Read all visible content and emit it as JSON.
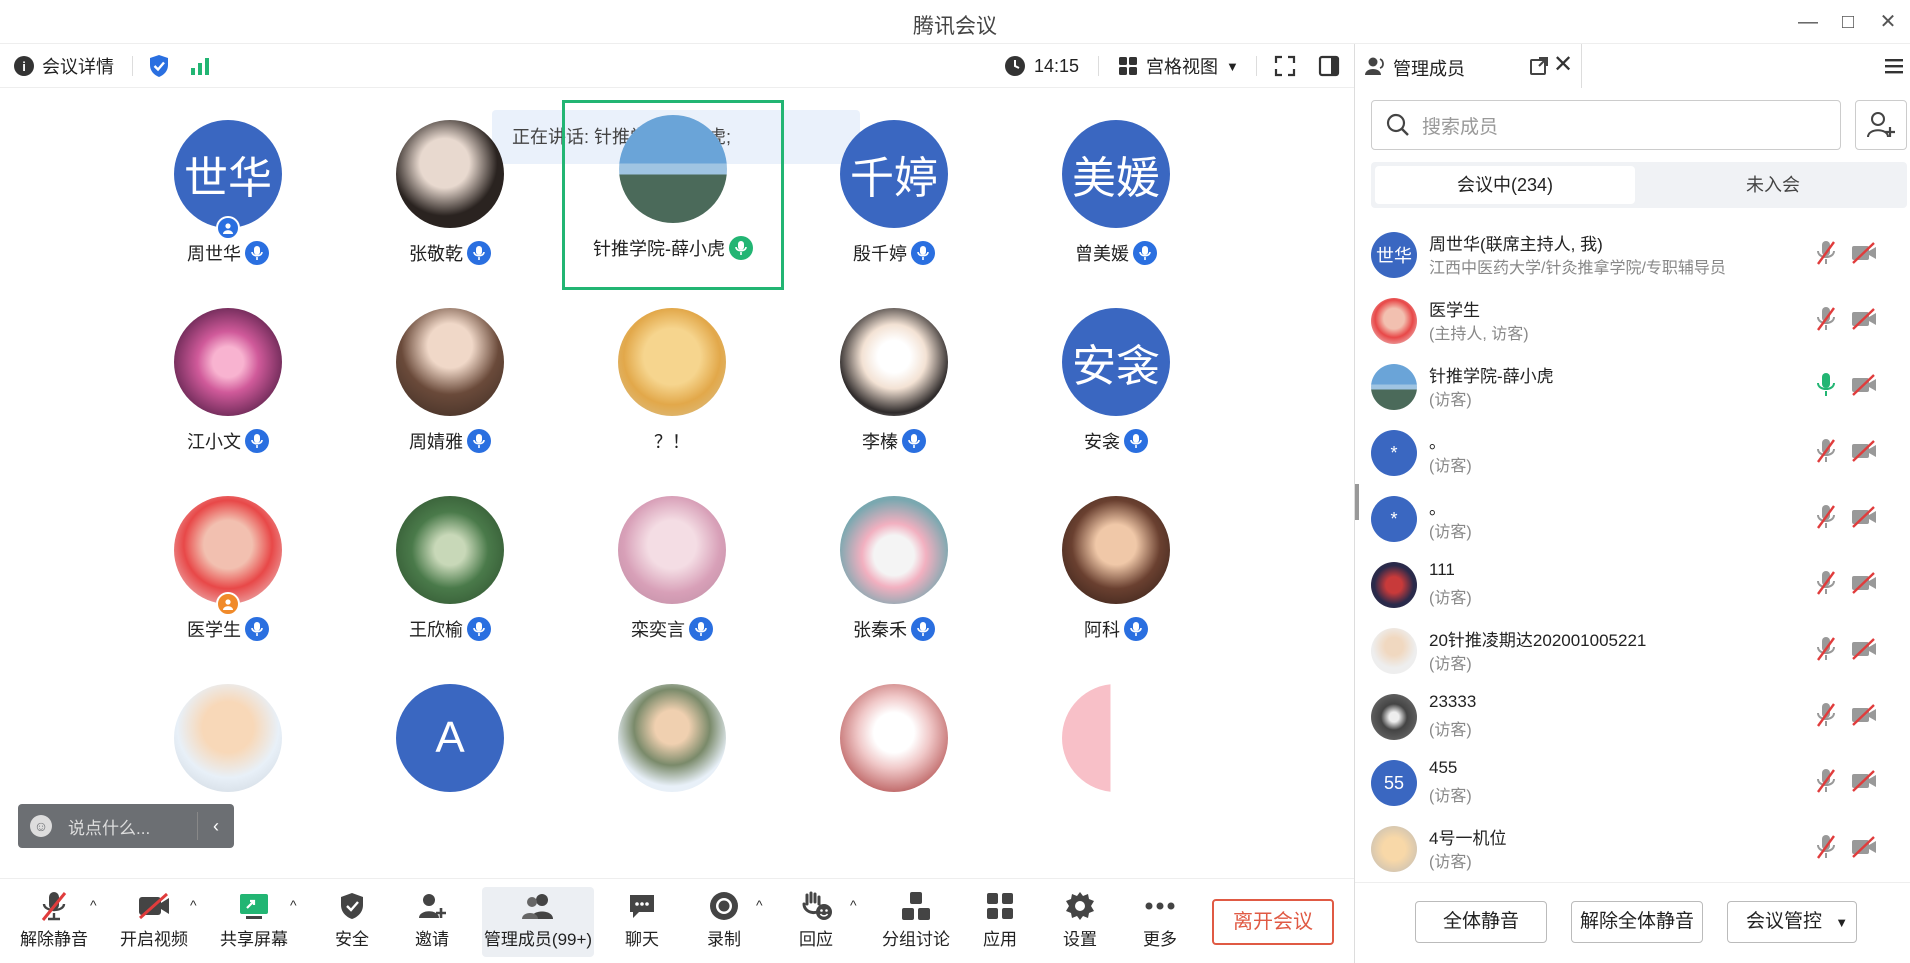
{
  "window": {
    "title": "腾讯会议"
  },
  "topbar": {
    "details_label": "会议详情",
    "time": "14:15",
    "view_label": "宫格视图"
  },
  "speaking": {
    "text": "正在讲话: 针推学院-薛小虎;"
  },
  "participants": [
    {
      "name": "周世华",
      "avatar_text": "世华",
      "mic": "on",
      "role": "host"
    },
    {
      "name": "张敬乾",
      "avatar_text": "",
      "mic": "on"
    },
    {
      "name": "针推学院-薛小虎",
      "avatar_text": "",
      "mic": "speaking",
      "active": true
    },
    {
      "name": "殷千婷",
      "avatar_text": "千婷",
      "mic": "on"
    },
    {
      "name": "曾美媛",
      "avatar_text": "美媛",
      "mic": "on"
    },
    {
      "name": "江小文",
      "avatar_text": "",
      "mic": "on"
    },
    {
      "name": "周婧雅",
      "avatar_text": "",
      "mic": "on"
    },
    {
      "name": "？！",
      "avatar_text": "",
      "mic": "none"
    },
    {
      "name": "李榛",
      "avatar_text": "",
      "mic": "on"
    },
    {
      "name": "安衾",
      "avatar_text": "安衾",
      "mic": "on"
    },
    {
      "name": "医学生",
      "avatar_text": "",
      "mic": "on",
      "role": "cohost"
    },
    {
      "name": "王欣榆",
      "avatar_text": "",
      "mic": "on"
    },
    {
      "name": "栾奕言",
      "avatar_text": "",
      "mic": "on"
    },
    {
      "name": "张秦禾",
      "avatar_text": "",
      "mic": "on"
    },
    {
      "name": "阿科",
      "avatar_text": "",
      "mic": "on"
    },
    {
      "name": "",
      "avatar_text": "",
      "mic": "none"
    },
    {
      "name": "",
      "avatar_text": "A",
      "mic": "none"
    },
    {
      "name": "",
      "avatar_text": "",
      "mic": "none"
    },
    {
      "name": "",
      "avatar_text": "",
      "mic": "none"
    },
    {
      "name": "",
      "avatar_text": "",
      "mic": "none"
    }
  ],
  "chat_input": {
    "placeholder": "说点什么..."
  },
  "toolbar": {
    "unmute": "解除静音",
    "start_video": "开启视频",
    "share_screen": "共享屏幕",
    "security": "安全",
    "invite": "邀请",
    "manage_members": "管理成员(99+)",
    "chat": "聊天",
    "record": "录制",
    "react": "回应",
    "breakout": "分组讨论",
    "apps": "应用",
    "settings": "设置",
    "more": "更多",
    "leave": "离开会议"
  },
  "panel": {
    "title": "管理成员",
    "search_placeholder": "搜索成员",
    "tab_in": "会议中(234)",
    "tab_not_joined": "未入会",
    "members": [
      {
        "name": "周世华(联席主持人, 我)",
        "sub": "江西中医药大学/针灸推拿学院/专职辅导员",
        "avatar_text": "世华",
        "mic": "muted"
      },
      {
        "name": "医学生",
        "sub": "(主持人, 访客)",
        "avatar_text": "",
        "mic": "muted"
      },
      {
        "name": "针推学院-薛小虎",
        "sub": "(访客)",
        "avatar_text": "",
        "mic": "on"
      },
      {
        "name": "。",
        "sub": "(访客)",
        "avatar_text": "*",
        "mic": "muted"
      },
      {
        "name": "。",
        "sub": "(访客)",
        "avatar_text": "*",
        "mic": "muted"
      },
      {
        "name": "111",
        "sub": "(访客)",
        "avatar_text": "",
        "mic": "muted"
      },
      {
        "name": "20针推凌期达202001005221",
        "sub": "(访客)",
        "avatar_text": "",
        "mic": "muted"
      },
      {
        "name": "23333",
        "sub": "(访客)",
        "avatar_text": "",
        "mic": "muted"
      },
      {
        "name": "455",
        "sub": "(访客)",
        "avatar_text": "55",
        "mic": "muted"
      },
      {
        "name": "4号一机位",
        "sub": "(访客)",
        "avatar_text": "",
        "mic": "muted"
      }
    ],
    "mute_all": "全体静音",
    "unmute_all": "解除全体静音",
    "control": "会议管控"
  },
  "colors": {
    "accent": "#2a6fe0",
    "speaking": "#22b573",
    "leave": "#e05a44",
    "avatar_blue": "#3a67c1"
  }
}
